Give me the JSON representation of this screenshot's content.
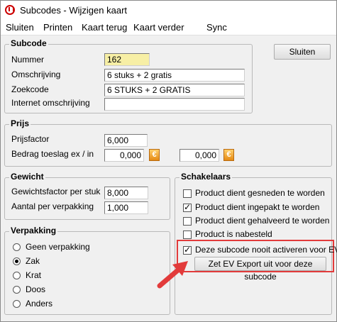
{
  "window": {
    "title": "Subcodes - Wijzigen kaart"
  },
  "menu": {
    "sluiten": "Sluiten",
    "printen": "Printen",
    "kaart_terug": "Kaart terug",
    "kaart_verder": "Kaart verder",
    "sync": "Sync"
  },
  "subcode": {
    "title": "Subcode",
    "nummer_label": "Nummer",
    "nummer_value": "162",
    "omschrijving_label": "Omschrijving",
    "omschrijving_value": "6 stuks + 2 gratis",
    "zoekcode_label": "Zoekcode",
    "zoekcode_value": "6 STUKS + 2 GRATIS",
    "internet_label": "Internet omschrijving",
    "internet_value": ""
  },
  "close_button": "Sluiten",
  "prijs": {
    "title": "Prijs",
    "prijsfactor_label": "Prijsfactor",
    "prijsfactor_value": "6,000",
    "toeslag_label": "Bedrag toeslag ex / in",
    "toeslag_ex_value": "0,000",
    "toeslag_in_value": "0,000",
    "currency_symbol": "€"
  },
  "gewicht": {
    "title": "Gewicht",
    "factor_label": "Gewichtsfactor per stuk",
    "factor_value": "8,000",
    "aantal_label": "Aantal per verpakking",
    "aantal_value": "1,000"
  },
  "verpakking": {
    "title": "Verpakking",
    "options": [
      "Geen verpakking",
      "Zak",
      "Krat",
      "Doos",
      "Anders"
    ],
    "selected": "Zak"
  },
  "schakelaars": {
    "title": "Schakelaars",
    "checks": [
      {
        "label": "Product dient gesneden te worden",
        "checked": false
      },
      {
        "label": "Product dient ingepakt te worden",
        "checked": true
      },
      {
        "label": "Product dient gehalveerd te worden",
        "checked": false
      },
      {
        "label": "Product is nabesteld",
        "checked": false
      },
      {
        "label": "Deze subcode nooit activeren voor EV",
        "checked": true
      }
    ],
    "ev_button": "Zet EV Export uit voor deze subcode"
  },
  "colors": {
    "annotation": "#e23b3b",
    "highlight_field": "#f7efa5",
    "euro": "#f0a020"
  }
}
